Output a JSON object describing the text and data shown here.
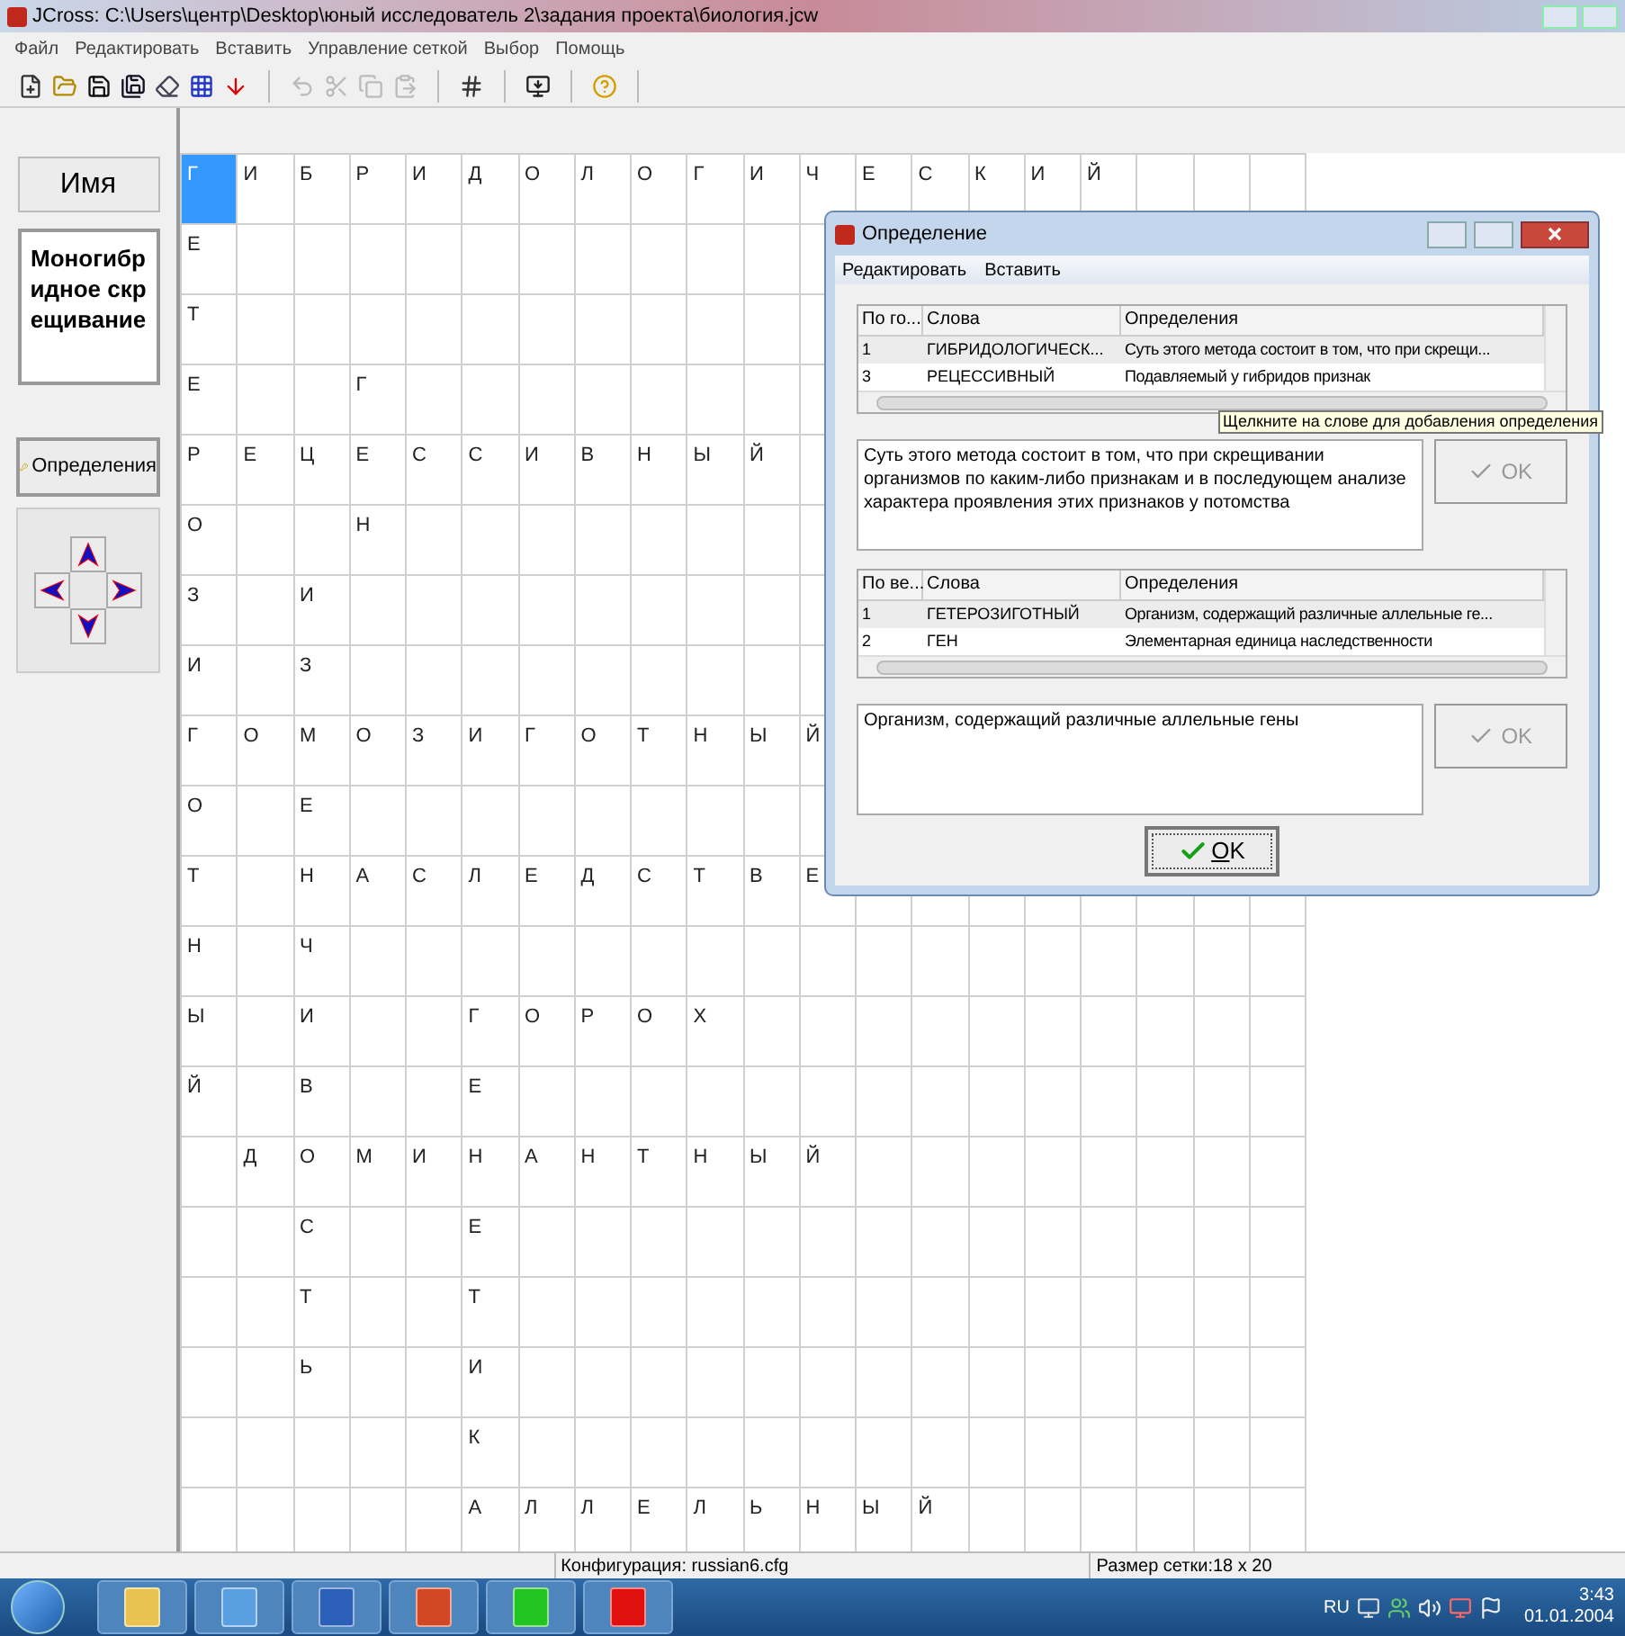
{
  "window": {
    "title": "JCross: C:\\Users\\центр\\Desktop\\юный исследователь 2\\задания проекта\\биология.jcw"
  },
  "menu": [
    "Файл",
    "Редактировать",
    "Вставить",
    "Управление сеткой",
    "Выбор",
    "Помощь"
  ],
  "toolbar": [
    {
      "kind": "new",
      "disabled": false
    },
    {
      "kind": "open",
      "disabled": false
    },
    {
      "kind": "save",
      "disabled": false
    },
    {
      "kind": "saveas",
      "disabled": false
    },
    {
      "kind": "erase",
      "disabled": false
    },
    {
      "kind": "fill",
      "disabled": false
    },
    {
      "kind": "down",
      "disabled": false
    },
    {
      "kind": "sep"
    },
    {
      "kind": "undo",
      "disabled": true
    },
    {
      "kind": "cut",
      "disabled": true
    },
    {
      "kind": "copy",
      "disabled": true
    },
    {
      "kind": "paste",
      "disabled": true
    },
    {
      "kind": "sep"
    },
    {
      "kind": "grid",
      "disabled": false
    },
    {
      "kind": "sep"
    },
    {
      "kind": "export",
      "disabled": false
    },
    {
      "kind": "sep"
    },
    {
      "kind": "help",
      "disabled": false
    },
    {
      "kind": "sep"
    }
  ],
  "left_panel": {
    "name_button": "Имя",
    "word": "Моногибридное скрещивание",
    "definitions_button": "Определения"
  },
  "grid": {
    "rows": [
      [
        {
          "l": "Г",
          "selected": true
        },
        {
          "l": "И",
          "selected": false
        },
        {
          "l": "Б",
          "selected": false
        },
        {
          "l": "Р",
          "selected": false
        },
        {
          "l": "И",
          "selected": false
        },
        {
          "l": "Д",
          "selected": false
        },
        {
          "l": "О",
          "selected": false
        },
        {
          "l": "Л",
          "selected": false
        },
        {
          "l": "О",
          "selected": false
        },
        {
          "l": "Г",
          "selected": false
        },
        {
          "l": "И",
          "selected": false
        },
        {
          "l": "Ч",
          "selected": false
        },
        {
          "l": "Е",
          "selected": false
        },
        {
          "l": "С",
          "selected": false
        },
        {
          "l": "К",
          "selected": false
        },
        {
          "l": "И",
          "selected": false
        },
        {
          "l": "Й",
          "selected": false
        }
      ],
      [
        {
          "l": "Е",
          "selected": false
        }
      ],
      [
        {
          "l": "Т",
          "selected": false
        }
      ],
      [
        {
          "l": "Е",
          "selected": false
        },
        null,
        null,
        {
          "l": "Г",
          "selected": false
        }
      ],
      [
        {
          "l": "Р",
          "selected": false
        },
        {
          "l": "Е",
          "selected": false
        },
        {
          "l": "Ц",
          "selected": false
        },
        {
          "l": "Е",
          "selected": false
        },
        {
          "l": "С",
          "selected": false
        },
        {
          "l": "С",
          "selected": false
        },
        {
          "l": "И",
          "selected": false
        },
        {
          "l": "В",
          "selected": false
        },
        {
          "l": "Н",
          "selected": false
        },
        {
          "l": "Ы",
          "selected": false
        },
        {
          "l": "Й",
          "selected": false
        }
      ],
      [
        {
          "l": "О",
          "selected": false
        },
        null,
        null,
        {
          "l": "Н",
          "selected": false
        }
      ],
      [
        {
          "l": "З",
          "selected": false
        },
        null,
        {
          "l": "И",
          "selected": false
        }
      ],
      [
        {
          "l": "И",
          "selected": false
        },
        null,
        {
          "l": "З",
          "selected": false
        }
      ],
      [
        {
          "l": "Г",
          "selected": false
        },
        {
          "l": "О",
          "selected": false
        },
        {
          "l": "М",
          "selected": false
        },
        {
          "l": "О",
          "selected": false
        },
        {
          "l": "З",
          "selected": false
        },
        {
          "l": "И",
          "selected": false
        },
        {
          "l": "Г",
          "selected": false
        },
        {
          "l": "О",
          "selected": false
        },
        {
          "l": "Т",
          "selected": false
        },
        {
          "l": "Н",
          "selected": false
        },
        {
          "l": "Ы",
          "selected": false
        },
        {
          "l": "Й",
          "selected": false
        }
      ],
      [
        {
          "l": "О",
          "selected": false
        },
        null,
        {
          "l": "Е",
          "selected": false
        }
      ],
      [
        {
          "l": "Т",
          "selected": false
        },
        null,
        {
          "l": "Н",
          "selected": false
        },
        {
          "l": "А",
          "selected": false
        },
        {
          "l": "С",
          "selected": false
        },
        {
          "l": "Л",
          "selected": false
        },
        {
          "l": "Е",
          "selected": false
        },
        {
          "l": "Д",
          "selected": false
        },
        {
          "l": "С",
          "selected": false
        },
        {
          "l": "Т",
          "selected": false
        },
        {
          "l": "В",
          "selected": false
        },
        {
          "l": "Е",
          "selected": false
        }
      ],
      [
        {
          "l": "Н",
          "selected": false
        },
        null,
        {
          "l": "Ч",
          "selected": false
        }
      ],
      [
        {
          "l": "Ы",
          "selected": false
        },
        null,
        {
          "l": "И",
          "selected": false
        },
        null,
        null,
        {
          "l": "Г",
          "selected": false
        },
        {
          "l": "О",
          "selected": false
        },
        {
          "l": "Р",
          "selected": false
        },
        {
          "l": "О",
          "selected": false
        },
        {
          "l": "Х",
          "selected": false
        }
      ],
      [
        {
          "l": "Й",
          "selected": false
        },
        null,
        {
          "l": "В",
          "selected": false
        },
        null,
        null,
        {
          "l": "Е",
          "selected": false
        }
      ],
      [
        null,
        {
          "l": "Д",
          "selected": false
        },
        {
          "l": "О",
          "selected": false
        },
        {
          "l": "М",
          "selected": false
        },
        {
          "l": "И",
          "selected": false
        },
        {
          "l": "Н",
          "selected": false
        },
        {
          "l": "А",
          "selected": false
        },
        {
          "l": "Н",
          "selected": false
        },
        {
          "l": "Т",
          "selected": false
        },
        {
          "l": "Н",
          "selected": false
        },
        {
          "l": "Ы",
          "selected": false
        },
        {
          "l": "Й",
          "selected": false
        }
      ],
      [
        null,
        null,
        {
          "l": "С",
          "selected": false
        },
        null,
        null,
        {
          "l": "Е",
          "selected": false
        }
      ],
      [
        null,
        null,
        {
          "l": "Т",
          "selected": false
        },
        null,
        null,
        {
          "l": "Т",
          "selected": false
        }
      ],
      [
        null,
        null,
        {
          "l": "Ь",
          "selected": false
        },
        null,
        null,
        {
          "l": "И",
          "selected": false
        }
      ],
      [
        null,
        null,
        null,
        null,
        null,
        {
          "l": "К",
          "selected": false
        }
      ],
      [
        null,
        null,
        null,
        null,
        null,
        {
          "l": "А",
          "selected": false
        },
        {
          "l": "Л",
          "selected": false
        },
        {
          "l": "Л",
          "selected": false
        },
        {
          "l": "Е",
          "selected": false
        },
        {
          "l": "Л",
          "selected": false
        },
        {
          "l": "Ь",
          "selected": false
        },
        {
          "l": "Н",
          "selected": false
        },
        {
          "l": "Ы",
          "selected": false
        },
        {
          "l": "Й",
          "selected": false
        }
      ]
    ]
  },
  "dialog": {
    "title": "Определение",
    "menu": [
      "Редактировать",
      "Вставить"
    ],
    "lists": [
      {
        "columns": [
          "По го...",
          "Слова",
          "Определения"
        ],
        "rows": [
          {
            "number": "1",
            "word": "ГИБРИДОЛОГИЧЕСК...",
            "definition": "Суть этого метода состоит в том, что при скрещи...",
            "selected": true
          },
          {
            "number": "3",
            "word": "РЕЦЕССИВНЫЙ",
            "definition": "Подавляемый у гибридов признак",
            "selected": false
          }
        ],
        "text": "Суть этого метода состоит в том, что при скрещивании организмов по каким-либо признакам и в последующем анализе характера проявления этих признаков у потомства",
        "ok": {
          "label": "OK",
          "disabled": true
        }
      },
      {
        "columns": [
          "По ве...",
          "Слова",
          "Определения"
        ],
        "rows": [
          {
            "number": "1",
            "word": "ГЕТЕРОЗИГОТНЫЙ",
            "definition": "Организм, содержащий различные аллельные ге...",
            "selected": true
          },
          {
            "number": "2",
            "word": "ГЕН",
            "definition": "Элементарная единица наследственности",
            "selected": false
          }
        ],
        "text": "Организм, содержащий различные аллельные гены",
        "ok": {
          "label": "OK",
          "disabled": true
        }
      }
    ],
    "ok_button": "OK",
    "tooltip": "Щелкните на слове для добавления определения"
  },
  "status_bar": [
    "Конфигурация: russian6.cfg",
    "Размер сетки:18 x 20"
  ],
  "taskbar": {
    "apps": [
      {
        "kind": "explorer"
      },
      {
        "kind": "messenger"
      },
      {
        "kind": "word"
      },
      {
        "kind": "powerpoint"
      },
      {
        "kind": "jcross-green"
      },
      {
        "kind": "jcross-red"
      }
    ],
    "language": "RU",
    "time": "3:43",
    "date": "01.01.2004"
  }
}
